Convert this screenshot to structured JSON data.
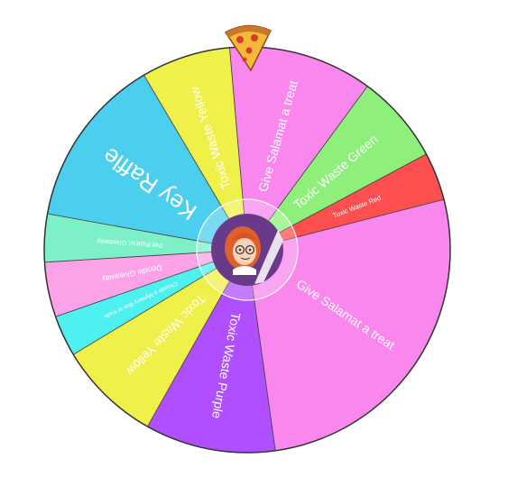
{
  "wheel": {
    "segments": [
      {
        "label": "Give Salamat a treat",
        "color": "#f987ee",
        "text_color": "#ffffff"
      },
      {
        "label": "Toxic Waste Green",
        "color": "#8ef07b",
        "text_color": "#ffffff"
      },
      {
        "label": "Toxic Waste Red",
        "color": "#fd4f4f",
        "text_color": "#ffffff"
      },
      {
        "label": "Give Salamat a treat",
        "color": "#f987ee",
        "text_color": "#ffffff"
      },
      {
        "label": "Toxic Waste Purple",
        "color": "#b04fff",
        "text_color": "#ffffff"
      },
      {
        "label": "Toxic Waste Yellow",
        "color": "#f0f04a",
        "text_color": "#ffffff"
      },
      {
        "label": "Choose a Mystery Box to trade",
        "color": "#4ef0f0",
        "text_color": "#ffffff"
      },
      {
        "label": "Doodle Giveaway",
        "color": "#fba2e8",
        "text_color": "#ffffff"
      },
      {
        "label": "Pet Portrait Giveaway",
        "color": "#7ef0c8",
        "text_color": "#ffffff"
      },
      {
        "label": "Key Raffle",
        "color": "#4ccfee",
        "text_color": "#ffffff"
      },
      {
        "label": "Toxic Waste Yellow",
        "color": "#f0f04a",
        "text_color": "#ffffff"
      }
    ],
    "weights": [
      2.1,
      1.3,
      0.7,
      4.9,
      1.9,
      1.5,
      0.6,
      0.8,
      0.7,
      2.5,
      1.3
    ],
    "pointer_icon": "pizza-slice-icon",
    "center_icon": "avatar-icon",
    "outline_color": "#333333",
    "center_ring_color": "#6a3a8a"
  }
}
